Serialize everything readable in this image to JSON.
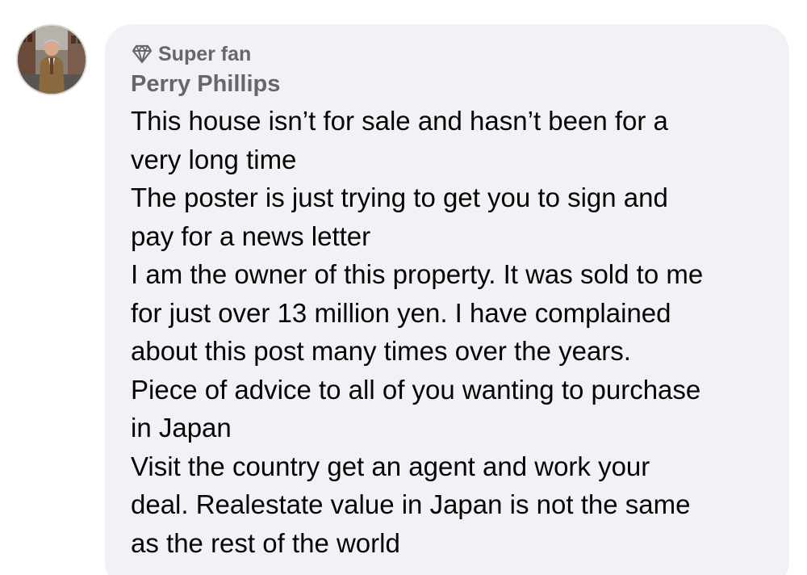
{
  "comment": {
    "badge": {
      "icon": "diamond-icon",
      "label": "Super fan"
    },
    "author": {
      "name": "Perry Phillips",
      "avatar_icon": "profile-photo"
    },
    "lines": [
      "This house isn’t for sale and hasn’t been for a",
      "very long time",
      "The poster is just trying to get you to sign and",
      "pay for a news letter",
      "I am the owner of this property. It was sold to me",
      "for just over 13 million yen. I have complained",
      "about this post many times over the years.",
      "Piece of advice to all of you wanting to purchase",
      "in Japan",
      "Visit the country get an agent and work your",
      "deal. Realestate value in Japan is not the same",
      "as the rest of the world"
    ]
  },
  "colors": {
    "bubble_background": "#f0f2f5",
    "secondary_text": "#65676b",
    "primary_text": "#050505"
  }
}
